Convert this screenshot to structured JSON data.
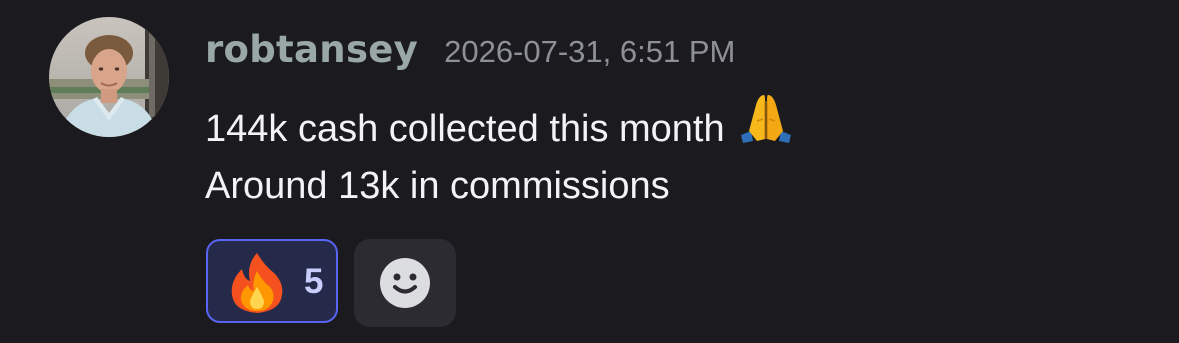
{
  "message": {
    "username": "robtansey",
    "timestamp": "2026-07-31, 6:51 PM",
    "lines": [
      "144k cash collected this month",
      "Around 13k in commissions"
    ],
    "inline_emoji": "folded-hands-emoji"
  },
  "reactions": [
    {
      "emoji": "fire-emoji",
      "count": "5",
      "selected": true
    }
  ],
  "add_reaction": {
    "icon": "smiley-icon"
  },
  "colors": {
    "background": "#1b1b1f",
    "username": "#99a7a7",
    "timestamp": "#8e9097",
    "text": "#f2f3f5",
    "reaction_border": "#5865f2",
    "reaction_bg": "#252a4a",
    "add_reaction_bg": "#2b2b31"
  }
}
